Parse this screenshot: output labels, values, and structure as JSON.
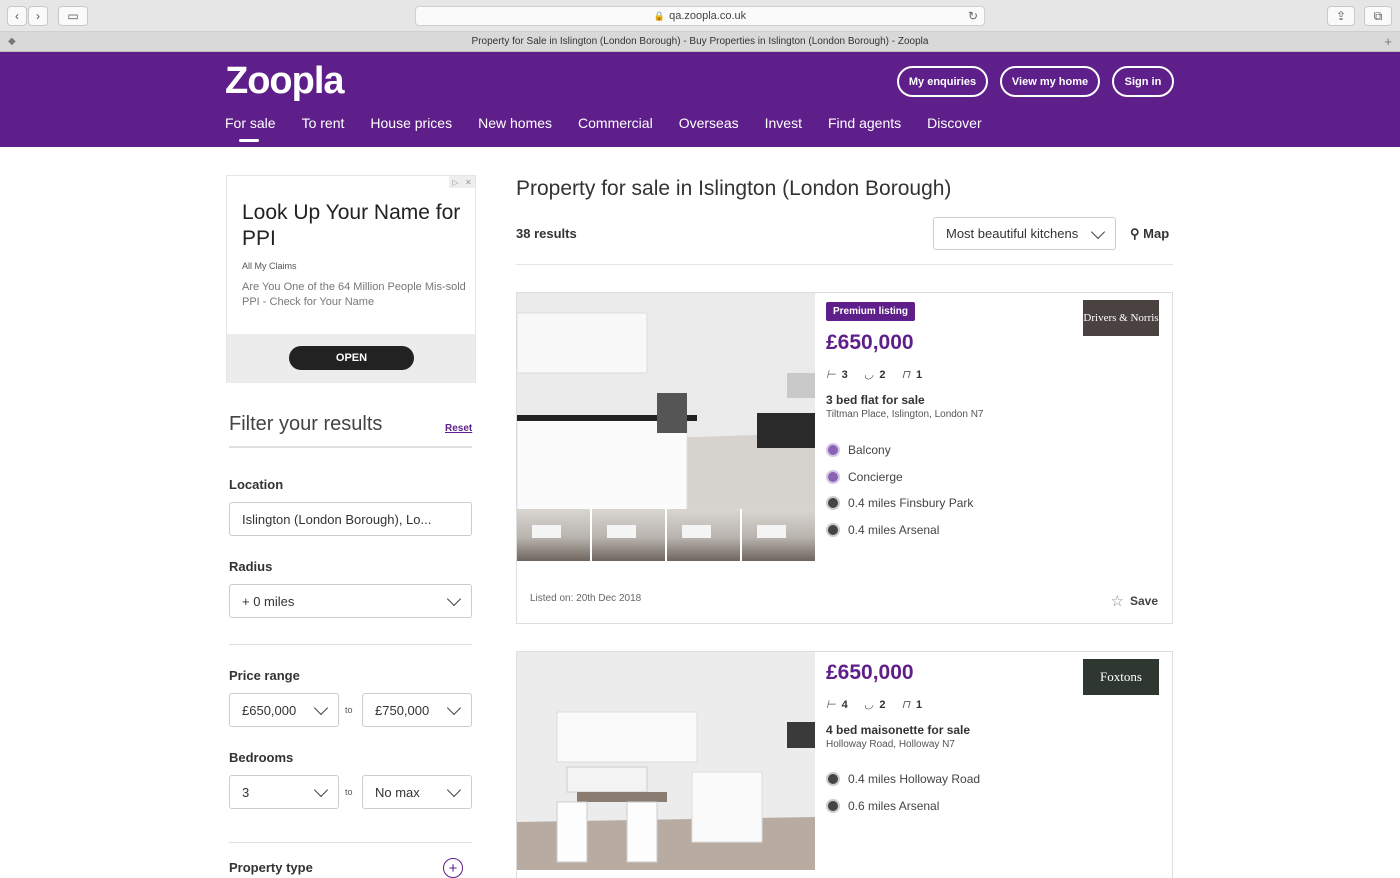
{
  "browser": {
    "url": "qa.zoopla.co.uk",
    "tab_title": "Property for Sale in Islington (London Borough) - Buy Properties in Islington (London Borough) - Zoopla"
  },
  "header": {
    "logo": "Zoopla",
    "buttons": [
      "My enquiries",
      "View my home",
      "Sign in"
    ],
    "nav": [
      "For sale",
      "To rent",
      "House prices",
      "New homes",
      "Commercial",
      "Overseas",
      "Invest",
      "Find agents",
      "Discover"
    ]
  },
  "ad": {
    "title": "Look Up Your Name for PPI",
    "source": "All My Claims",
    "text": "Are You One of the 64 Million People Mis-sold PPI - Check for Your Name",
    "cta": "OPEN"
  },
  "filters": {
    "title": "Filter your results",
    "reset": "Reset",
    "location_label": "Location",
    "location_value": "Islington (London Borough), Lo...",
    "radius_label": "Radius",
    "radius_value": "+ 0 miles",
    "price_label": "Price range",
    "price_min": "£650,000",
    "price_max": "£750,000",
    "bedrooms_label": "Bedrooms",
    "bed_min": "3",
    "bed_max": "No max",
    "to": "to",
    "property_type_label": "Property type"
  },
  "results": {
    "title": "Property for sale in Islington (London Borough)",
    "count": "38 results",
    "sort": "Most beautiful kitchens",
    "map": "Map"
  },
  "listings": [
    {
      "badge": "Premium listing",
      "price": "£650,000",
      "beds": "3",
      "baths": "2",
      "receptions": "1",
      "title": "3 bed flat for sale",
      "address": "Tiltman Place, Islington, London N7",
      "features": [
        "Balcony",
        "Concierge",
        "0.4 miles Finsbury Park",
        "0.4 miles Arsenal"
      ],
      "agent": "Drivers & Norris",
      "listed": "Listed on: 20th Dec 2018",
      "save": "Save"
    },
    {
      "price": "£650,000",
      "beds": "4",
      "baths": "2",
      "receptions": "1",
      "title": "4 bed maisonette for sale",
      "address": "Holloway Road, Holloway N7",
      "features": [
        "0.4 miles Holloway Road",
        "0.6 miles Arsenal"
      ],
      "agent": "Foxtons"
    }
  ],
  "colors": {
    "brand": "#5f1f8a"
  }
}
